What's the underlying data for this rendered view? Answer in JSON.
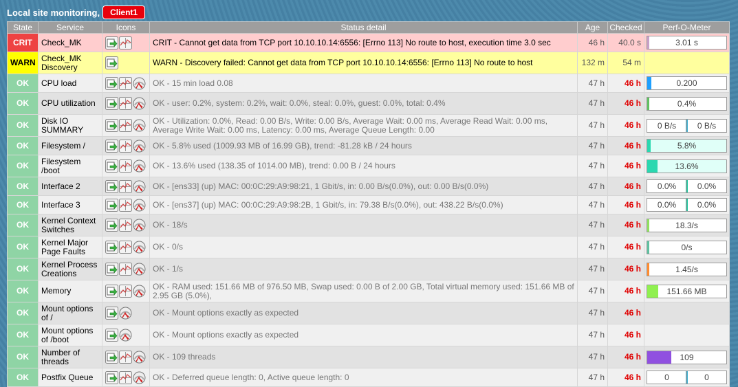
{
  "header": {
    "title": "Local site monitoring,",
    "host_button": "Client1"
  },
  "columns": [
    "State",
    "Service",
    "Icons",
    "Status detail",
    "Age",
    "Checked",
    "Perf-O-Meter"
  ],
  "rows": [
    {
      "state": "CRIT",
      "service": "Check_MK",
      "icons": [
        "action",
        "graph"
      ],
      "detail": "CRIT - Cannot get data from TCP port 10.10.10.14:6556: [Errno 113] No route to host, execution time 3.0 sec",
      "age": "46 h",
      "checked": "40.0 s",
      "stale": false,
      "perf": {
        "type": "single",
        "label": "3.01 s",
        "fill": 0.01,
        "color": "#c8a0c8"
      }
    },
    {
      "state": "WARN",
      "service": "Check_MK Discovery",
      "icons": [
        "action"
      ],
      "detail": "WARN - Discovery failed: Cannot get data from TCP port 10.10.10.14:6556: [Errno 113] No route to host",
      "age": "132 m",
      "checked": "54 m",
      "stale": false,
      "perf": null
    },
    {
      "state": "OK",
      "service": "CPU load",
      "icons": [
        "action",
        "graph",
        "gauge"
      ],
      "detail": "OK - 15 min load 0.08",
      "age": "47 h",
      "checked": "46 h",
      "stale": true,
      "perf": {
        "type": "single",
        "label": "0.200",
        "fill": 0.05,
        "color": "#1ea0ff"
      }
    },
    {
      "state": "OK",
      "service": "CPU utilization",
      "icons": [
        "action",
        "graph",
        "gauge"
      ],
      "detail": "OK - user: 0.2%, system: 0.2%, wait: 0.0%, steal: 0.0%, guest: 0.0%, total: 0.4%",
      "age": "47 h",
      "checked": "46 h",
      "stale": true,
      "perf": {
        "type": "single",
        "label": "0.4%",
        "fill": 0.01,
        "color": "#60c060"
      }
    },
    {
      "state": "OK",
      "service": "Disk IO SUMMARY",
      "icons": [
        "action",
        "graph",
        "gauge"
      ],
      "detail": "OK - Utilization: 0.0%, Read: 0.00 B/s, Write: 0.00 B/s, Average Wait: 0.00 ms, Average Read Wait: 0.00 ms, Average Write Wait: 0.00 ms, Latency: 0.00 ms, Average Queue Length: 0.00",
      "age": "47 h",
      "checked": "46 h",
      "stale": true,
      "perf": {
        "type": "split",
        "labels": [
          "0 B/s",
          "0 B/s"
        ],
        "colors": [
          "#40b0d0",
          "#40b0d0"
        ],
        "fills": [
          0.005,
          0.005
        ]
      }
    },
    {
      "state": "OK",
      "service": "Filesystem /",
      "icons": [
        "action",
        "graph",
        "gauge"
      ],
      "detail": "OK - 5.8% used (1009.93 MB of 16.99 GB), trend: -81.28 kB / 24 hours",
      "age": "47 h",
      "checked": "46 h",
      "stale": true,
      "perf": {
        "type": "single",
        "label": "5.8%",
        "fill": 0.04,
        "color": "#2ad8b0",
        "bg": "#e0fff8"
      }
    },
    {
      "state": "OK",
      "service": "Filesystem /boot",
      "icons": [
        "action",
        "graph",
        "gauge"
      ],
      "detail": "OK - 13.6% used (138.35 of 1014.00 MB), trend: 0.00 B / 24 hours",
      "age": "47 h",
      "checked": "46 h",
      "stale": true,
      "perf": {
        "type": "single",
        "label": "13.6%",
        "fill": 0.13,
        "color": "#2ad8b0",
        "bg": "#e0fff8"
      }
    },
    {
      "state": "OK",
      "service": "Interface 2",
      "icons": [
        "action",
        "graph",
        "gauge"
      ],
      "detail": "OK - [ens33] (up) MAC: 00:0C:29:A9:98:21, 1 Gbit/s, in: 0.00 B/s(0.0%), out: 0.00 B/s(0.0%)",
      "age": "47 h",
      "checked": "46 h",
      "stale": true,
      "perf": {
        "type": "split",
        "labels": [
          "0.0%",
          "0.0%"
        ],
        "colors": [
          "#20c8a0",
          "#20c8a0"
        ],
        "fills": [
          0.02,
          0.02
        ]
      }
    },
    {
      "state": "OK",
      "service": "Interface 3",
      "icons": [
        "action",
        "graph",
        "gauge"
      ],
      "detail": "OK - [ens37] (up) MAC: 00:0C:29:A9:98:2B, 1 Gbit/s, in: 79.38 B/s(0.0%), out: 438.22 B/s(0.0%)",
      "age": "47 h",
      "checked": "46 h",
      "stale": true,
      "perf": {
        "type": "split",
        "labels": [
          "0.0%",
          "0.0%"
        ],
        "colors": [
          "#20c8a0",
          "#20c8a0"
        ],
        "fills": [
          0.02,
          0.02
        ]
      }
    },
    {
      "state": "OK",
      "service": "Kernel Context Switches",
      "icons": [
        "action",
        "graph",
        "gauge"
      ],
      "detail": "OK - 18/s",
      "age": "47 h",
      "checked": "46 h",
      "stale": true,
      "perf": {
        "type": "single",
        "label": "18.3/s",
        "fill": 0.03,
        "color": "#90e060"
      }
    },
    {
      "state": "OK",
      "service": "Kernel Major Page Faults",
      "icons": [
        "action",
        "graph",
        "gauge"
      ],
      "detail": "OK - 0/s",
      "age": "47 h",
      "checked": "46 h",
      "stale": true,
      "perf": {
        "type": "single",
        "label": "0/s",
        "fill": 0.005,
        "color": "#60c0a0"
      }
    },
    {
      "state": "OK",
      "service": "Kernel Process Creations",
      "icons": [
        "action",
        "graph",
        "gauge"
      ],
      "detail": "OK - 1/s",
      "age": "47 h",
      "checked": "46 h",
      "stale": true,
      "perf": {
        "type": "single",
        "label": "1.45/s",
        "fill": 0.03,
        "color": "#ff8c30"
      }
    },
    {
      "state": "OK",
      "service": "Memory",
      "icons": [
        "action",
        "graph",
        "gauge"
      ],
      "detail": "OK - RAM used: 151.66 MB of 976.50 MB, Swap used: 0.00 B of 2.00 GB, Total virtual memory used: 151.66 MB of 2.95 GB (5.0%),",
      "age": "47 h",
      "checked": "46 h",
      "stale": true,
      "perf": {
        "type": "single",
        "label": "151.66 MB",
        "fill": 0.14,
        "color": "#90f050"
      }
    },
    {
      "state": "OK",
      "service": "Mount options of /",
      "icons": [
        "action",
        "gauge"
      ],
      "detail": "OK - Mount options exactly as expected",
      "age": "47 h",
      "checked": "46 h",
      "stale": true,
      "perf": null
    },
    {
      "state": "OK",
      "service": "Mount options of /boot",
      "icons": [
        "action",
        "gauge"
      ],
      "detail": "OK - Mount options exactly as expected",
      "age": "47 h",
      "checked": "46 h",
      "stale": true,
      "perf": null
    },
    {
      "state": "OK",
      "service": "Number of threads",
      "icons": [
        "action",
        "graph",
        "gauge"
      ],
      "detail": "OK - 109 threads",
      "age": "47 h",
      "checked": "46 h",
      "stale": true,
      "perf": {
        "type": "single",
        "label": "109",
        "fill": 0.3,
        "color": "#9050e0"
      }
    },
    {
      "state": "OK",
      "service": "Postfix Queue",
      "icons": [
        "action",
        "graph",
        "gauge"
      ],
      "detail": "OK - Deferred queue length: 0, Active queue length: 0",
      "age": "47 h",
      "checked": "46 h",
      "stale": true,
      "perf": {
        "type": "split",
        "labels": [
          "0",
          "0"
        ],
        "colors": [
          "#40b0d0",
          "#40b0d0"
        ],
        "fills": [
          0.005,
          0.005
        ]
      }
    }
  ]
}
